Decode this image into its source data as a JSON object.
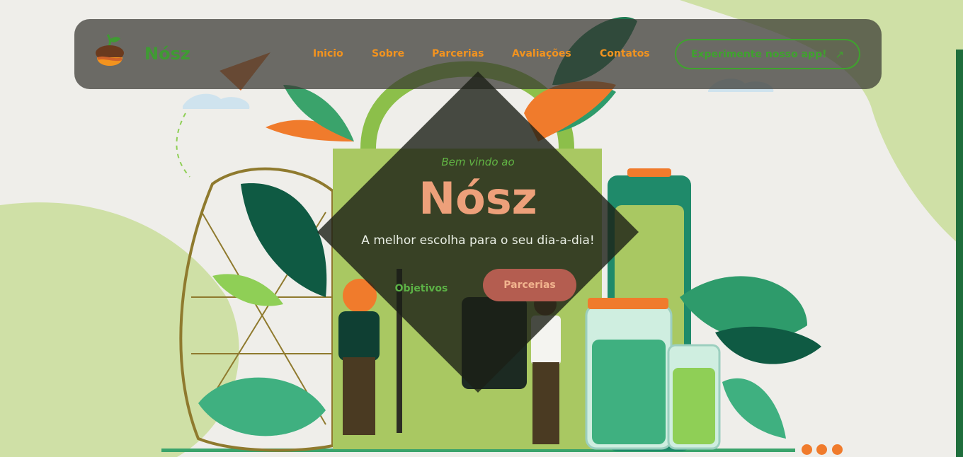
{
  "brand": {
    "name": "Nósz",
    "logo_icon": "acorn-icon"
  },
  "nav": {
    "links": [
      "Inicio",
      "Sobre",
      "Parcerias",
      "Avaliações",
      "Contatos"
    ],
    "cta_label": "Experimente nosso app!",
    "cta_icon": "arrow-up-right-icon"
  },
  "hero": {
    "subtitle": "Bem vindo ao",
    "title": "Nósz",
    "tagline": "A melhor escolha para o seu dia-a-dia!",
    "primary_button": "Objetivos",
    "secondary_button": "Parcerias"
  },
  "carousel": {
    "dot_count": 3
  },
  "colors": {
    "green_accent": "#3fa32e",
    "orange_nav": "#f2931f",
    "title_salmon": "#eda07a",
    "button_red": "#b45d50"
  }
}
